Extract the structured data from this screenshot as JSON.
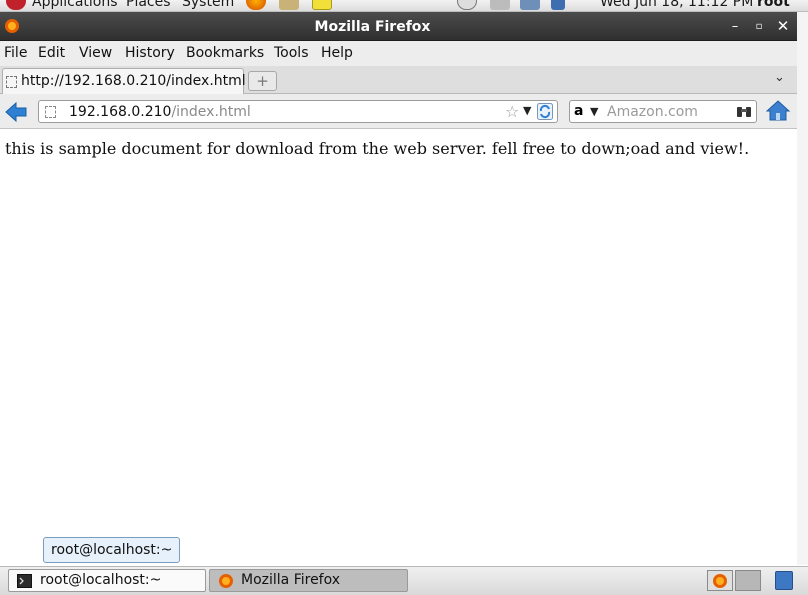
{
  "top_panel": {
    "applications": "Applications",
    "places": "Places",
    "system": "System",
    "clock": "Wed Jun 18, 11:12 PM",
    "user": "root"
  },
  "window": {
    "title": "Mozilla Firefox"
  },
  "menubar": {
    "file": "File",
    "edit": "Edit",
    "view": "View",
    "history": "History",
    "bookmarks": "Bookmarks",
    "tools": "Tools",
    "help": "Help"
  },
  "tabs": {
    "active_label": "http://192.168.0.210/index.html",
    "new_tab": "+"
  },
  "urlbar": {
    "host": "192.168.0.210",
    "path": "/index.html"
  },
  "search": {
    "engine_letter": "a",
    "placeholder": "Amazon.com"
  },
  "content": {
    "text": "this is sample document for download from the web server. fell free to down;oad and view!."
  },
  "tooltip": {
    "text": "root@localhost:~"
  },
  "taskbar": {
    "terminal": "root@localhost:~",
    "firefox": "Mozilla Firefox"
  }
}
